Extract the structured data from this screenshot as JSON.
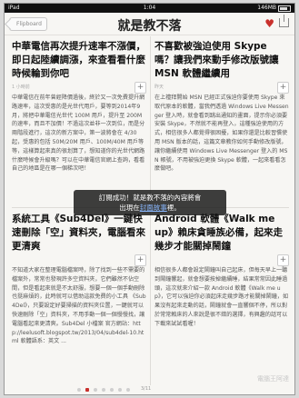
{
  "statusbar": {
    "left": "iPad",
    "time": "1:04",
    "battery": "146MB"
  },
  "header": {
    "back_label": "Flipboard",
    "title": "就是教不落"
  },
  "articles": [
    {
      "title": "中華電信再次提升速率不漲價，即日起陸續調漲，來查看看什麼時候輪到你吧",
      "meta": "1 小時前",
      "body": "中華電信在前年曾經降價過後，終於又一次免費提升網路速率，這次受惠的是光世代用戶，要等到2014年9月，將把中華電信光世代 100M 用戶，提升至 200M 的速率，而且不加價！不過這次並非一次到位，而是分兩階段進行，這次的新方案中，第一波將會在 4/30 起，受惠的包括 50M/20M 用戶、100M/40M 用戶等等，這樣算起來真的很划算了，想知道你的光世代網路什麼時候會升級嗎？可以在中華電信官網上查詢，看看自己的地區是在哪一個梯次吧！"
    },
    {
      "title": "不喜歡被強迫使用 Skype 嗎？讓我們來動手修改版號讓 MSN 軟體繼續用",
      "meta": "昨天",
      "body": "在上禮拜開始 MSN 已經正式強迫你要使用 Skype 來取代原本的軟體，當我們透過 Windows Live Messenger 登入時，就會看到跳出通知的畫面，提示你必須要安裝 Skype，不然就不能再登入，這種強迫使用的方式，相信很多人都覺得很困擾，如果你還是比較習慣使用 MSN 版本的話，這篇文章教你如何手動修改版號，讓你繼續使用 Windows Live Messenger 登入的 MSN 帳號，不用被強迫更換 Skype 軟體，一起來看看怎麼做吧。"
    },
    {
      "title": "系統工具《Sub4Del》一鍵快速刪除「空」資料夾，電腦看來更清爽",
      "meta": "",
      "body": "不知道大家在整理電腦檔案時，除了找到一些不需要的檔案外，常常也發現許多空資料夾，它們雖然不佔空間，但是看起來就是不太舒服，想要一個一個手動刪除也挺麻煩的，此時就可以借助這款免費的小工具 《Sub4Del》，只要設定好要掃描的資料夾位置，一鍵就可以快速刪除「空」資料夾，不用手動一個一個慢慢找，讓電腦看起來更清爽。Sub4Del 小檔案 官方網站：http://leelusoft.blogspot.tw/2013/04/sub4del-10.html 軟體語系：英文 ..."
    },
    {
      "title": "Android 軟體《Walk me up》賴床貪睡族必備，起來走幾步才能關掉鬧鐘",
      "meta": "",
      "body": "相信很多人都會設定鬧鐘叫自己起床，但每天早上一聽到鬧鐘響起，就會想要按掉繼續睡，結果常常因此睡過頭，這次就來介紹一款 Android 軟體《Walk me up》，它可以強迫你必須起床走幾步路才能關掉鬧鐘，如果沒有起來走動的話，鬧鐘就會一直響個不停，所以對於常常賴床的人來說是很不錯的選擇，有興趣的話可以下載來試試看喔！"
    }
  ],
  "toast": {
    "line1": "訂閱成功！就是教不落的內容將會",
    "line2_prefix": "出現在",
    "line2_link": "封面故事",
    "line2_suffix": "裡。"
  },
  "pager": {
    "total_dots": 7,
    "active_dot": 1,
    "page_label": "3/11"
  },
  "watermark": "電腦王阿達",
  "colors": {
    "accent": "#c9302c",
    "toast_bg": "#141414",
    "link": "#8ab8ff"
  }
}
